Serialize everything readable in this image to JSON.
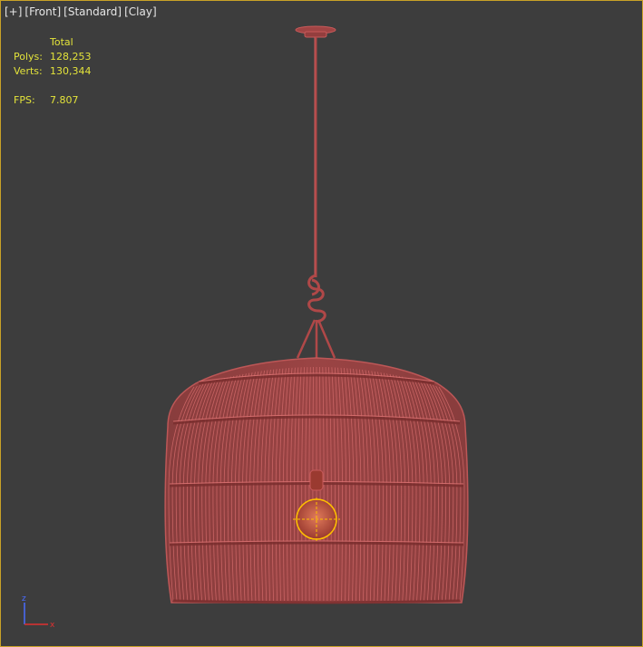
{
  "viewport": {
    "labels": [
      "[+]",
      "[Front]",
      "[Standard]",
      "[Clay]"
    ],
    "border_color": "#c9a227",
    "background": "#3d3d3d"
  },
  "stats": {
    "header": "Total",
    "polys_label": "Polys:",
    "polys_value": "128,253",
    "verts_label": "Verts:",
    "verts_value": "130,344",
    "fps_label": "FPS:",
    "fps_value": "7.807",
    "color": "#e3e33a"
  },
  "model": {
    "name": "wicker-pendant-lamp",
    "wire_color": "#b04848",
    "selection_color": "#ffc000"
  },
  "axis_gizmo": {
    "labels": [
      "z",
      "x"
    ],
    "z_color": "#4a6cff",
    "x_color": "#e03030"
  }
}
